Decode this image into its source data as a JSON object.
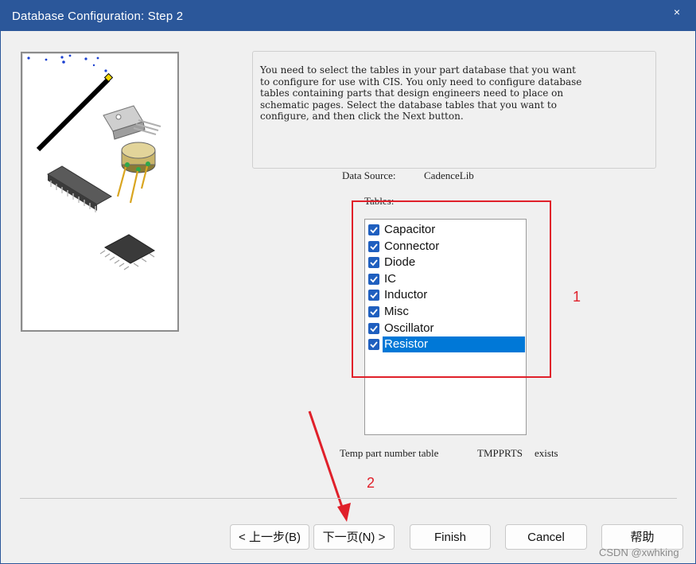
{
  "window": {
    "title": "Database Configuration: Step 2",
    "close_glyph": "×"
  },
  "icons": {
    "close": "close-icon",
    "art": "electronic-components-illustration",
    "checkbox": "check-icon"
  },
  "colors": {
    "titlebar": "#2b579a",
    "selection": "#0078d7",
    "checkbox": "#1f5fbf",
    "annotation": "#e0202a"
  },
  "info": {
    "text": "You need to select the tables in your part database that you want\nto configure for use with CIS. You only need to configure database\ntables containing parts that design engineers need to place on\nschematic pages. Select the database tables that you want to\nconfigure, and then click the Next button."
  },
  "data_source": {
    "label": "Data Source:",
    "value": "CadenceLib"
  },
  "tables": {
    "label": "Tables:",
    "items": [
      {
        "label": "Capacitor",
        "checked": true,
        "selected": false
      },
      {
        "label": "Connector",
        "checked": true,
        "selected": false
      },
      {
        "label": "Diode",
        "checked": true,
        "selected": false
      },
      {
        "label": "IC",
        "checked": true,
        "selected": false
      },
      {
        "label": "Inductor",
        "checked": true,
        "selected": false
      },
      {
        "label": "Misc",
        "checked": true,
        "selected": false
      },
      {
        "label": "Oscillator",
        "checked": true,
        "selected": false
      },
      {
        "label": "Resistor",
        "checked": true,
        "selected": true
      }
    ]
  },
  "temp_table": {
    "prefix": "Temp part number table",
    "name": "TMPPRTS",
    "status": "exists"
  },
  "annotations": {
    "one": "1",
    "two": "2"
  },
  "buttons": {
    "back": "< 上一步(B)",
    "next": "下一页(N) >",
    "finish": "Finish",
    "cancel": "Cancel",
    "help": "帮助"
  },
  "watermark": "CSDN @xwhking"
}
